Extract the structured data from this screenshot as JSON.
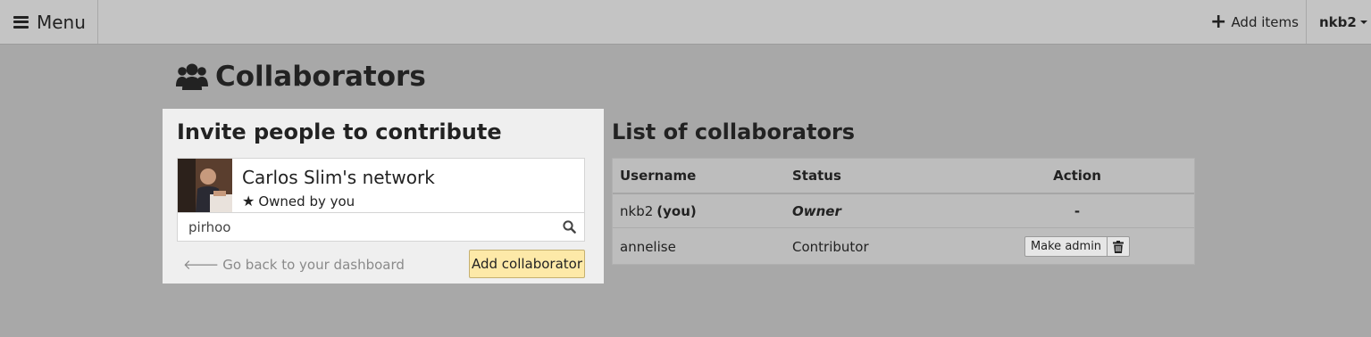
{
  "navbar": {
    "menu_label": "Menu",
    "add_items_label": "Add items",
    "user_label": "nkb2"
  },
  "page": {
    "title": "Collaborators"
  },
  "invite": {
    "heading": "Invite people to contribute",
    "network_name": "Carlos Slim's network",
    "owner_label": "Owned by you",
    "search_value": "pirhoo",
    "back_link": "Go back to your dashboard",
    "add_button": "Add collaborator"
  },
  "collaborators": {
    "heading": "List of collaborators",
    "columns": [
      "Username",
      "Status",
      "Action"
    ],
    "rows": [
      {
        "username": "nkb2",
        "you_tag": "(you)",
        "status": "Owner",
        "action": "-"
      },
      {
        "username": "annelise",
        "status": "Contributor",
        "action": "Make admin"
      }
    ]
  },
  "icons": {
    "menu": "hamburger-icon",
    "add": "plus-icon",
    "caret": "caret-down-icon",
    "title": "users-icon",
    "owner": "star-icon",
    "search": "search-icon",
    "back": "arrow-left-icon",
    "delete": "trash-icon"
  },
  "colors": {
    "background": "#a8a8a8",
    "navbar": "#c4c4c4",
    "panel": "#efefef",
    "primary_button": "#fde9a8",
    "table": "#bdbdbd"
  }
}
